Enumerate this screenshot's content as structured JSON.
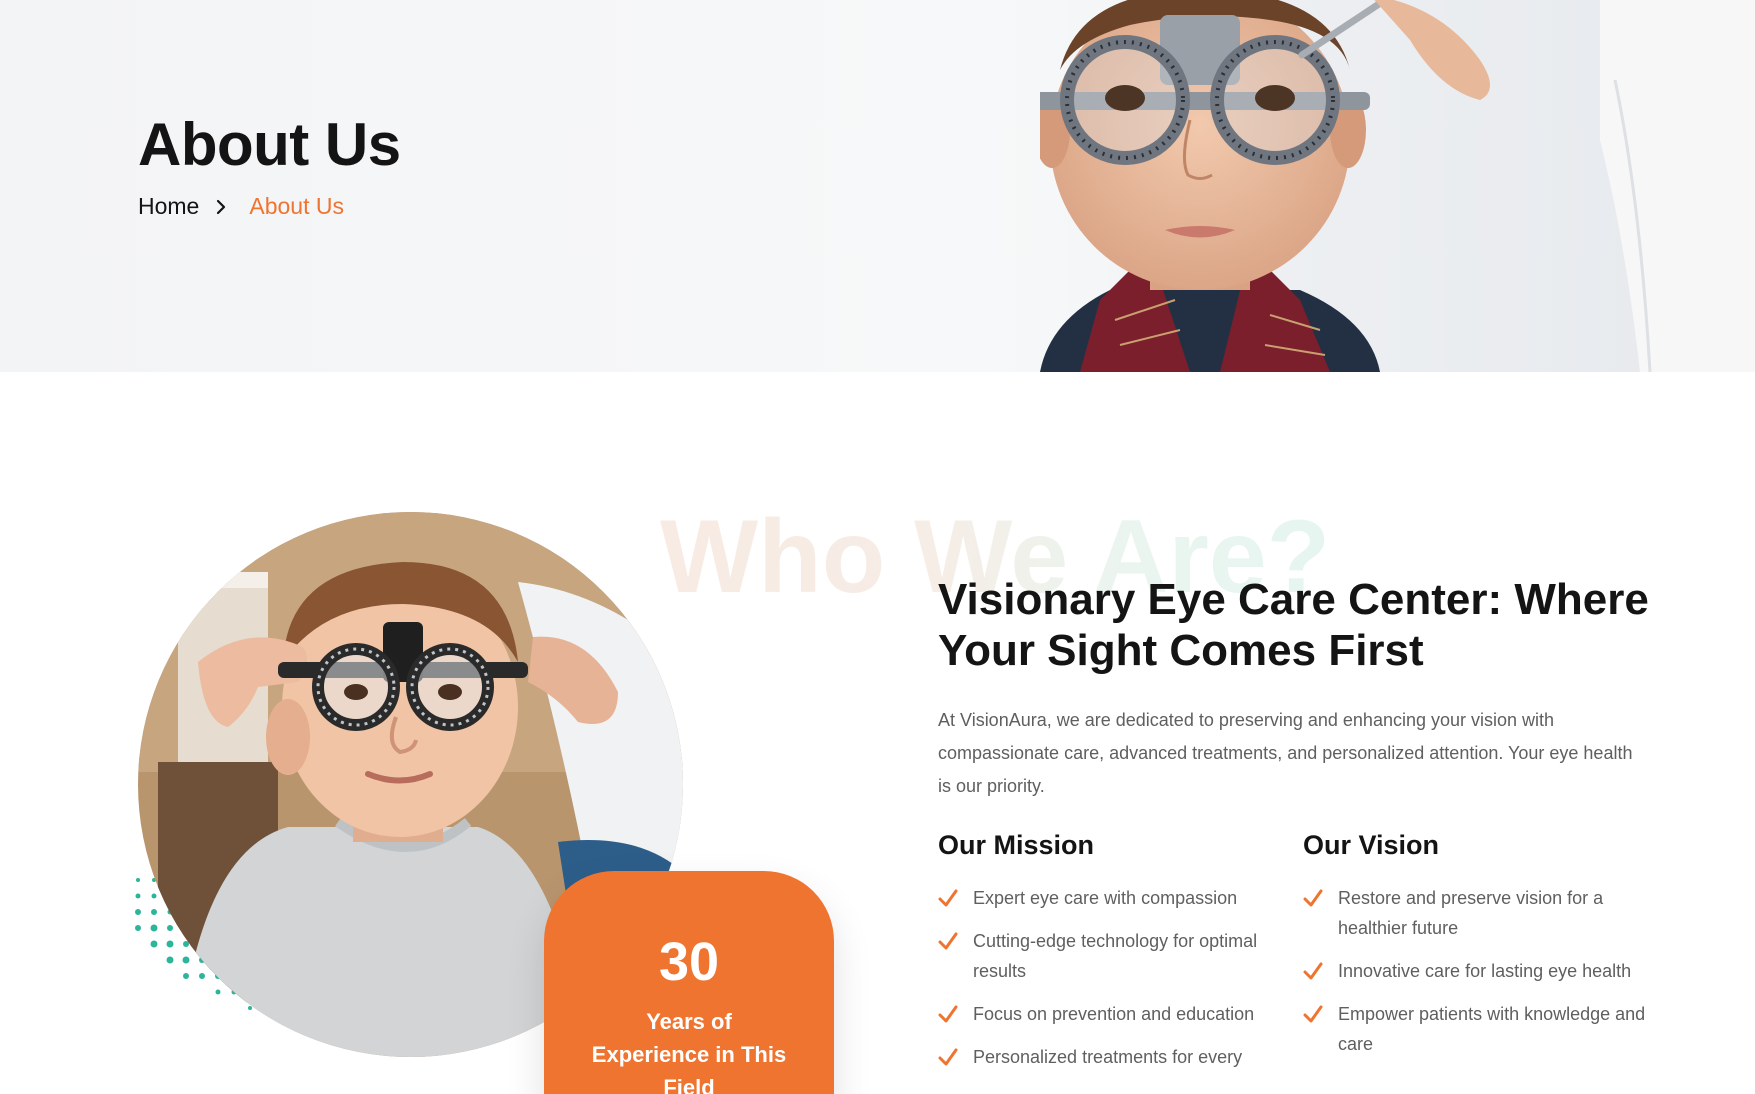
{
  "colors": {
    "accent": "#ef7430",
    "text": "#141414",
    "muted": "#5f5f5f",
    "dots": "#2bb59a"
  },
  "hero": {
    "title": "About Us",
    "breadcrumb": {
      "home": "Home",
      "current": "About Us"
    }
  },
  "about": {
    "watermark": "Who We Are?",
    "heading": "Visionary Eye Care Center: Where Your Sight Comes First",
    "intro": "At VisionAura, we are dedicated to preserving and enhancing your vision with compassionate care, advanced treatments, and personalized attention. Your eye health is our priority.",
    "experience": {
      "number": "30",
      "text": "Years of Experience in This Field"
    },
    "mission": {
      "title": "Our Mission",
      "items": [
        "Expert eye care with compassion",
        "Cutting-edge technology for optimal results",
        "Focus on prevention and education",
        "Personalized treatments for every"
      ]
    },
    "vision": {
      "title": "Our Vision",
      "items": [
        "Restore and preserve vision for a healthier future",
        "Innovative care for lasting eye health",
        "Empower patients with knowledge and care"
      ]
    }
  }
}
